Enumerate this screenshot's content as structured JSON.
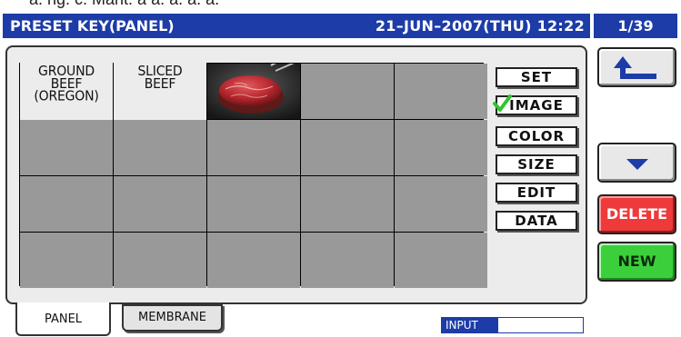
{
  "top_fragment": "a. ng. c. Mant. a a. a. a. a.",
  "header": {
    "title": "PRESET KEY(PANEL)",
    "datetime": "21–JUN–2007(THU) 12:22",
    "page_indicator": "1/39"
  },
  "grid": {
    "cells": [
      {
        "label": "GROUND\nBEEF\n(OREGON)"
      },
      {
        "label": "SLICED\nBEEF"
      },
      {
        "image": "steak-image"
      },
      {},
      {},
      {},
      {},
      {},
      {},
      {},
      {},
      {},
      {},
      {},
      {},
      {},
      {},
      {},
      {},
      {}
    ]
  },
  "side_buttons": {
    "set": "SET",
    "image": "IMAGE",
    "image_checked": true,
    "color": "COLOR",
    "size": "SIZE",
    "edit": "EDIT",
    "data": "DATA"
  },
  "right_buttons": {
    "back_icon": "return-arrow-icon",
    "down_icon": "down-triangle-icon",
    "delete": "DELETE",
    "new": "NEW"
  },
  "tabs": {
    "panel": "PANEL",
    "membrane": "MEMBRANE"
  },
  "input": {
    "label": "INPUT",
    "value": ""
  },
  "colors": {
    "header_blue": "#1d3ca7",
    "delete_red": "#ee3a3a",
    "new_green": "#3bd03b",
    "empty_cell": "#999999",
    "check_green": "#2fc42f"
  }
}
